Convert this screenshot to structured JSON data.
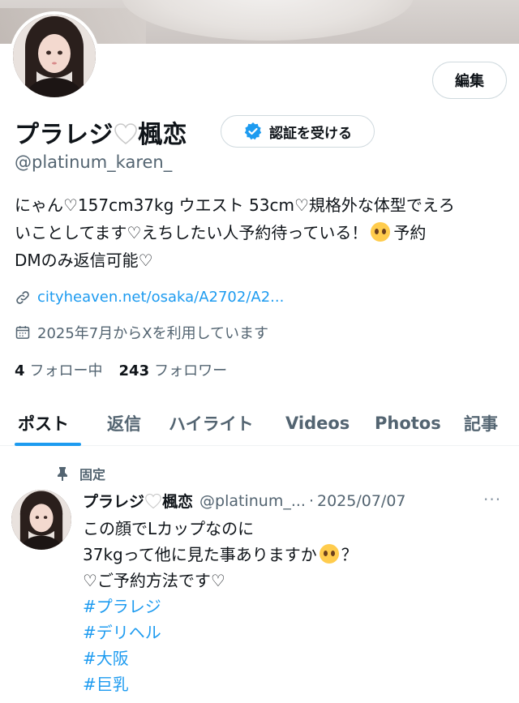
{
  "profile": {
    "edit_label": "編集",
    "display_name_a": "プラレジ",
    "display_name_b": "楓恋",
    "verify_label": "認証を受ける",
    "handle": "@platinum_karen_",
    "bio_line1": "にゃん♡157cm37kg ウエスト 53cm♡規格外な体型でえろ",
    "bio_line2a": "いことしてます♡えちしたい人予約待っている！",
    "bio_line2b": "予約",
    "bio_line3": "DMのみ返信可能♡",
    "link": "cityheaven.net/osaka/A2702/A2...",
    "joined": "2025年7月からXを利用しています",
    "following_count": "4",
    "following_label": "フォロー中",
    "followers_count": "243",
    "followers_label": "フォロワー"
  },
  "tabs": [
    "ポスト",
    "返信",
    "ハイライト",
    "Videos",
    "Photos",
    "記事"
  ],
  "pinned_tweet": {
    "pinned_label": "固定",
    "name_a": "プラレジ",
    "name_b": "楓恋",
    "handle": "@platinum_...",
    "dot": "·",
    "date": "2025/07/07",
    "more": "···",
    "line1": "この顔でLカップなのに",
    "line2a": "37kgって他に見た事ありますか",
    "line2b": "？",
    "line3": "♡ご予約方法です♡",
    "hashtags": [
      "#プラレジ",
      "#デリヘル",
      "#大阪",
      "#巨乳"
    ]
  },
  "icons": {
    "verify": "verified-badge-icon",
    "link": "link-icon",
    "calendar": "calendar-icon",
    "pin": "pin-icon",
    "heart": "white-heart-icon",
    "emoji": "pleading-face-emoji"
  },
  "colors": {
    "accent": "#1d9bf0",
    "text": "#0f1419",
    "muted": "#536471"
  }
}
